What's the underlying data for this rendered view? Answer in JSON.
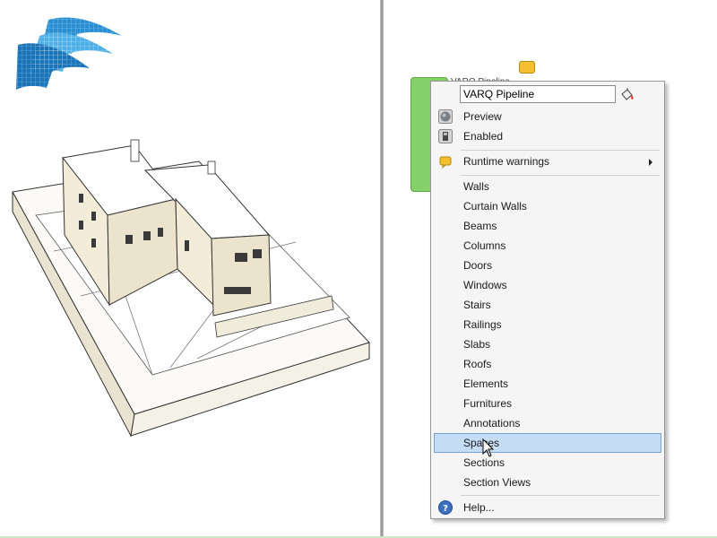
{
  "component": {
    "title": "VARQ Pipeline"
  },
  "menu": {
    "name_value": "VARQ Pipeline",
    "items": [
      {
        "label": "Preview",
        "icon": "preview-sphere-icon"
      },
      {
        "label": "Enabled",
        "icon": "enabled-icon"
      },
      {
        "label": "Runtime warnings",
        "icon": "warning-balloon-icon",
        "submenu": true
      },
      {
        "label": "Walls"
      },
      {
        "label": "Curtain Walls"
      },
      {
        "label": "Beams"
      },
      {
        "label": "Columns"
      },
      {
        "label": "Doors"
      },
      {
        "label": "Windows"
      },
      {
        "label": "Stairs"
      },
      {
        "label": "Railings"
      },
      {
        "label": "Slabs"
      },
      {
        "label": "Roofs"
      },
      {
        "label": "Elements"
      },
      {
        "label": "Furnitures"
      },
      {
        "label": "Annotations"
      },
      {
        "label": "Spaces",
        "highlighted": true
      },
      {
        "label": "Sections"
      },
      {
        "label": "Section Views"
      },
      {
        "label": "Help...",
        "icon": "help-icon"
      }
    ]
  },
  "colors": {
    "component_green": "#86d06a",
    "menu_highlight": "#c5dcf5",
    "logo_blue": "#1f8ad0"
  }
}
